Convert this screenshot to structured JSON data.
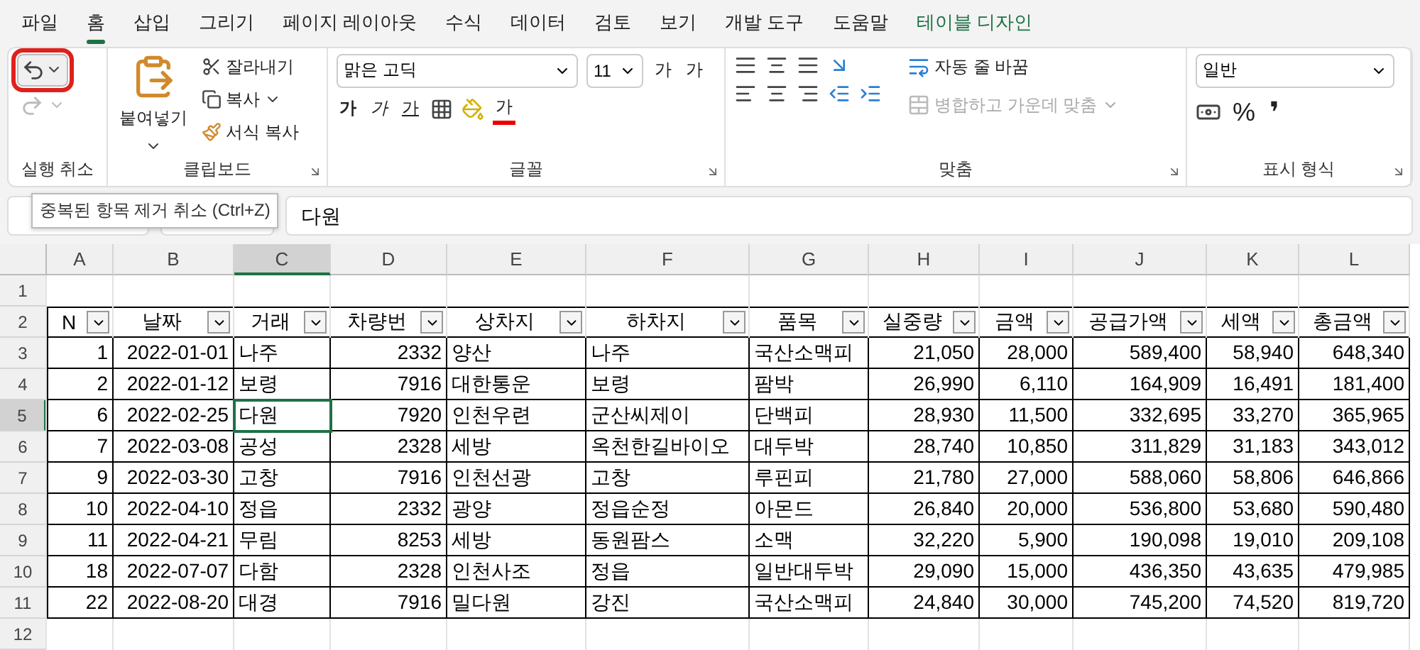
{
  "menu_tabs": [
    {
      "label": "파일",
      "selected": false,
      "kind": "normal"
    },
    {
      "label": "홈",
      "selected": true,
      "kind": "normal"
    },
    {
      "label": "삽입",
      "selected": false,
      "kind": "normal"
    },
    {
      "label": "그리기",
      "selected": false,
      "kind": "normal"
    },
    {
      "label": "페이지 레이아웃",
      "selected": false,
      "kind": "normal"
    },
    {
      "label": "수식",
      "selected": false,
      "kind": "normal"
    },
    {
      "label": "데이터",
      "selected": false,
      "kind": "normal"
    },
    {
      "label": "검토",
      "selected": false,
      "kind": "normal"
    },
    {
      "label": "보기",
      "selected": false,
      "kind": "normal"
    },
    {
      "label": "개발 도구",
      "selected": false,
      "kind": "normal"
    },
    {
      "label": "도움말",
      "selected": false,
      "kind": "normal"
    },
    {
      "label": "테이블 디자인",
      "selected": false,
      "kind": "contextual"
    }
  ],
  "ribbon": {
    "undo": {
      "label": "실행 취소",
      "highlighted": true
    },
    "clipboard": {
      "label": "클립보드",
      "paste": "붙여넣기",
      "cut": "잘라내기",
      "copy": "복사",
      "format_painter": "서식 복사"
    },
    "font": {
      "label": "글꼴",
      "font_name": "맑은 고딕",
      "font_size": "11",
      "grow": "가",
      "shrink": "가",
      "bold": "가",
      "italic": "가",
      "underline": "가",
      "font_color": "가"
    },
    "alignment": {
      "label": "맞춤",
      "wrap_text": "자동 줄 바꿈",
      "merge_center": {
        "label": "병합하고 가운데 맞춤",
        "disabled": true
      }
    },
    "number": {
      "label": "표시 형식",
      "format": "일반",
      "percent": "%",
      "comma": "❜"
    }
  },
  "tooltip": "중복된 항목 제거 취소 (Ctrl+Z)",
  "formula_bar": {
    "value": "다원"
  },
  "sheet": {
    "columns": [
      {
        "letter": "A",
        "selected": false,
        "kind": "number"
      },
      {
        "letter": "B",
        "selected": false,
        "kind": "number"
      },
      {
        "letter": "C",
        "selected": true,
        "kind": "text"
      },
      {
        "letter": "D",
        "selected": false,
        "kind": "number"
      },
      {
        "letter": "E",
        "selected": false,
        "kind": "text"
      },
      {
        "letter": "F",
        "selected": false,
        "kind": "text"
      },
      {
        "letter": "G",
        "selected": false,
        "kind": "text"
      },
      {
        "letter": "H",
        "selected": false,
        "kind": "number"
      },
      {
        "letter": "I",
        "selected": false,
        "kind": "number"
      },
      {
        "letter": "J",
        "selected": false,
        "kind": "number"
      },
      {
        "letter": "K",
        "selected": false,
        "kind": "number"
      },
      {
        "letter": "L",
        "selected": false,
        "kind": "number"
      }
    ],
    "rows": [
      {
        "number": "1",
        "selected": false,
        "kind": "empty"
      },
      {
        "number": "2",
        "selected": false,
        "kind": "header",
        "cells": [
          "N",
          "날짜",
          "거래",
          "차량번",
          "상차지",
          "하차지",
          "품목",
          "실중량",
          "금액",
          "공급가액",
          "세액",
          "총금액"
        ]
      },
      {
        "number": "3",
        "selected": false,
        "kind": "data",
        "cells": [
          "1",
          "2022-01-01",
          "나주",
          "2332",
          "양산",
          "나주",
          "국산소맥피",
          "21,050",
          "28,000",
          "589,400",
          "58,940",
          "648,340"
        ]
      },
      {
        "number": "4",
        "selected": false,
        "kind": "data",
        "cells": [
          "2",
          "2022-01-12",
          "보령",
          "7916",
          "대한통운",
          "보령",
          "팜박",
          "26,990",
          "6,110",
          "164,909",
          "16,491",
          "181,400"
        ]
      },
      {
        "number": "5",
        "selected": true,
        "kind": "data",
        "cells": [
          "6",
          "2022-02-25",
          "다원",
          "7920",
          "인천우련",
          "군산씨제이",
          "단백피",
          "28,930",
          "11,500",
          "332,695",
          "33,270",
          "365,965"
        ]
      },
      {
        "number": "6",
        "selected": false,
        "kind": "data",
        "cells": [
          "7",
          "2022-03-08",
          "공성",
          "2328",
          "세방",
          "옥천한길바이오",
          "대두박",
          "28,740",
          "10,850",
          "311,829",
          "31,183",
          "343,012"
        ]
      },
      {
        "number": "7",
        "selected": false,
        "kind": "data",
        "cells": [
          "9",
          "2022-03-30",
          "고창",
          "7916",
          "인천선광",
          "고창",
          "루핀피",
          "21,780",
          "27,000",
          "588,060",
          "58,806",
          "646,866"
        ]
      },
      {
        "number": "8",
        "selected": false,
        "kind": "data",
        "cells": [
          "10",
          "2022-04-10",
          "정읍",
          "2332",
          "광양",
          "정읍순정",
          "아몬드",
          "26,840",
          "20,000",
          "536,800",
          "53,680",
          "590,480"
        ]
      },
      {
        "number": "9",
        "selected": false,
        "kind": "data",
        "cells": [
          "11",
          "2022-04-21",
          "무림",
          "8253",
          "세방",
          "동원팜스",
          "소맥",
          "32,220",
          "5,900",
          "190,098",
          "19,010",
          "209,108"
        ]
      },
      {
        "number": "10",
        "selected": false,
        "kind": "data",
        "cells": [
          "18",
          "2022-07-07",
          "다함",
          "2328",
          "인천사조",
          "정읍",
          "일반대두박",
          "29,090",
          "15,000",
          "436,350",
          "43,635",
          "479,985"
        ]
      },
      {
        "number": "11",
        "selected": false,
        "kind": "data",
        "cells": [
          "22",
          "2022-08-20",
          "대경",
          "7916",
          "밀다원",
          "강진",
          "국산소맥피",
          "24,840",
          "30,000",
          "745,200",
          "74,520",
          "819,720"
        ]
      },
      {
        "number": "12",
        "selected": false,
        "kind": "empty"
      }
    ]
  }
}
